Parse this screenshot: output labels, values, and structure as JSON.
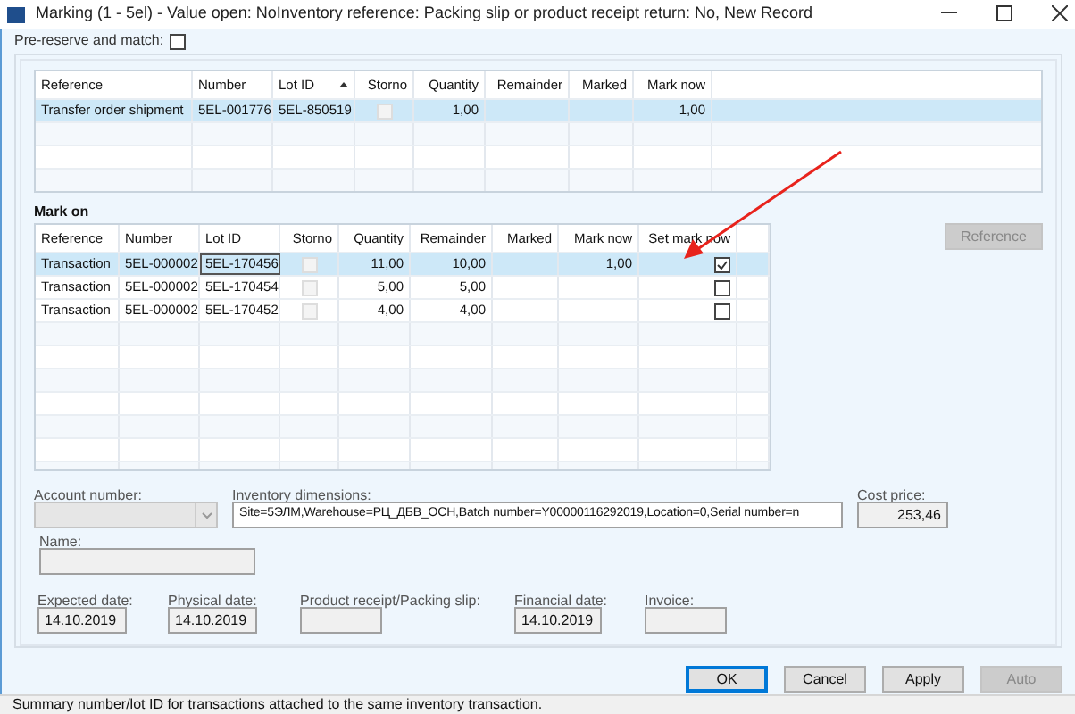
{
  "window": {
    "title": "Marking (1 - 5el) - Value open: NoInventory reference: Packing slip or product receipt return: No, New Record"
  },
  "pre_reserve": {
    "label": "Pre-reserve and match:",
    "checked": false
  },
  "issue_grid": {
    "columns": [
      {
        "label": "Reference",
        "sorted": false
      },
      {
        "label": "Number",
        "sorted": false
      },
      {
        "label": "Lot ID",
        "sorted": true
      },
      {
        "label": "Storno",
        "sorted": false
      },
      {
        "label": "Quantity",
        "sorted": false
      },
      {
        "label": "Remainder",
        "sorted": false
      },
      {
        "label": "Marked",
        "sorted": false
      },
      {
        "label": "Mark now",
        "sorted": false
      }
    ],
    "rows": [
      {
        "reference": "Transfer order shipment",
        "number": "5EL-001776",
        "lot_id": "5EL-850519",
        "storno": false,
        "quantity": "1,00",
        "mark_now": "1,00",
        "selected": true
      }
    ]
  },
  "mark_on": {
    "title": "Mark on",
    "columns": [
      "Reference",
      "Number",
      "Lot ID",
      "Storno",
      "Quantity",
      "Remainder",
      "Marked",
      "Mark now",
      "Set mark now"
    ],
    "rows": [
      {
        "reference": "Transaction",
        "number": "5EL-000002",
        "lot_id": "5EL-170456",
        "storno": false,
        "quantity": "11,00",
        "remainder": "10,00",
        "mark_now": "1,00",
        "set_mark_now": true,
        "selected": true
      },
      {
        "reference": "Transaction",
        "number": "5EL-000002",
        "lot_id": "5EL-170454",
        "storno": false,
        "quantity": "5,00",
        "remainder": "5,00",
        "set_mark_now": false,
        "selected": false
      },
      {
        "reference": "Transaction",
        "number": "5EL-000002",
        "lot_id": "5EL-170452",
        "storno": false,
        "quantity": "4,00",
        "remainder": "4,00",
        "set_mark_now": false,
        "selected": false
      }
    ]
  },
  "reference_button": {
    "label": "Reference",
    "disabled": true
  },
  "fields": {
    "account_number": {
      "label": "Account number:"
    },
    "inventory_dimensions": {
      "label": "Inventory dimensions:",
      "value": "Site=5ЭЛМ,Warehouse=РЦ_ДБВ_ОСН,Batch number=Y00000116292019,Location=0,Serial number=n"
    },
    "cost_price": {
      "label": "Cost price:",
      "value": "253,46"
    },
    "name": {
      "label": "Name:"
    },
    "expected_date": {
      "label": "Expected date:",
      "value": "14.10.2019"
    },
    "physical_date": {
      "label": "Physical date:",
      "value": "14.10.2019"
    },
    "product_receipt": {
      "label": "Product receipt/Packing slip:"
    },
    "financial_date": {
      "label": "Financial date:",
      "value": "14.10.2019"
    },
    "invoice": {
      "label": "Invoice:"
    }
  },
  "buttons": [
    {
      "label": "OK",
      "disabled": false,
      "default": true
    },
    {
      "label": "Cancel",
      "disabled": false,
      "default": false
    },
    {
      "label": "Apply",
      "disabled": false,
      "default": false
    },
    {
      "label": "Auto",
      "disabled": true,
      "default": false
    }
  ],
  "status_bar": {
    "text": "Summary number/lot ID for transactions attached to the same inventory transaction."
  }
}
